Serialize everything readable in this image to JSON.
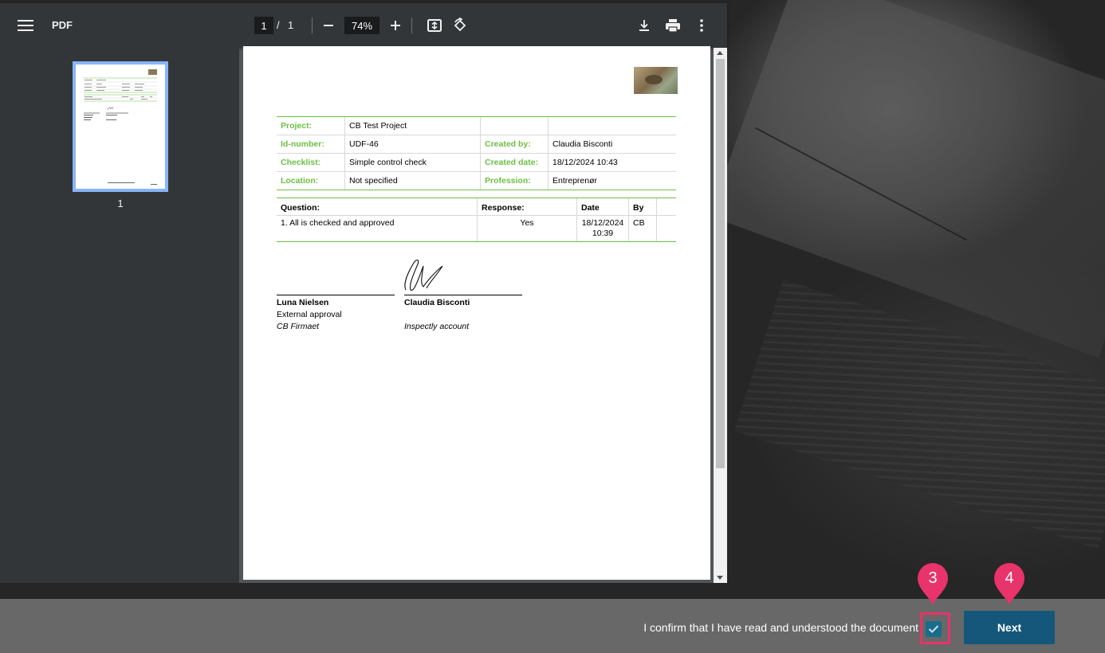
{
  "toolbar": {
    "title": "PDF",
    "page_current": "1",
    "page_separator": "/",
    "page_total": "1",
    "zoom": "74%"
  },
  "sidebar": {
    "thumbnails": [
      {
        "label": "1"
      }
    ]
  },
  "document": {
    "meta_rows": [
      {
        "l1": "Project:",
        "v1": "CB Test Project",
        "l2": "",
        "v2": ""
      },
      {
        "l1": "Id-number:",
        "v1": "UDF-46",
        "l2": "Created by:",
        "v2": "Claudia Bisconti"
      },
      {
        "l1": "Checklist:",
        "v1": "Simple control check",
        "l2": "Created date:",
        "v2": "18/12/2024 10:43"
      },
      {
        "l1": "Location:",
        "v1": "Not specified",
        "l2": "Profession:",
        "v2": "Entreprenør"
      }
    ],
    "questions_header": {
      "question": "Question:",
      "response": "Response:",
      "date": "Date",
      "by": "By"
    },
    "questions": [
      {
        "question": "1. All is checked and approved",
        "response": "Yes",
        "date_line1": "18/12/2024",
        "date_line2": "10:39",
        "by": "CB"
      }
    ],
    "signatures": [
      {
        "name": "Luna Nielsen",
        "role": "External approval",
        "company": "CB Firmaet"
      },
      {
        "name": "Claudia Bisconti",
        "role": "",
        "company": "Inspectly account"
      }
    ]
  },
  "footer": {
    "confirm_text": "I confirm that I have read and understood the document",
    "checkbox_checked": true,
    "next_label": "Next"
  },
  "annotations": [
    {
      "label": "3"
    },
    {
      "label": "4"
    }
  ],
  "colors": {
    "accent_green": "#6cbf45",
    "button": "#14577a",
    "checkbox": "#1b6b8c",
    "marker": "#e8336b"
  }
}
